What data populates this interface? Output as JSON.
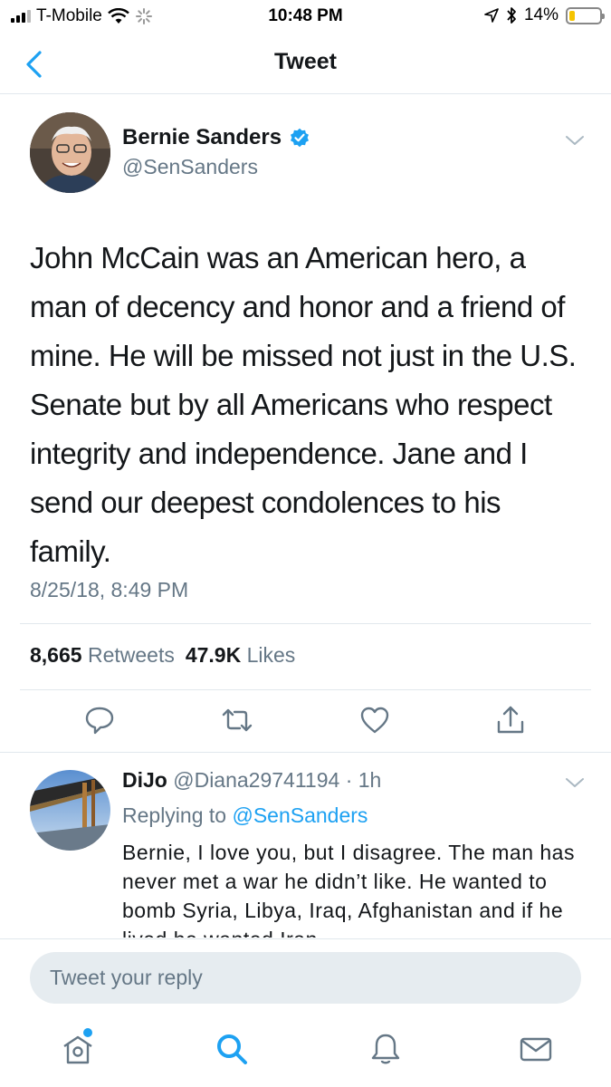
{
  "status_bar": {
    "carrier": "T-Mobile",
    "time": "10:48 PM",
    "battery": "14%",
    "battery_level": 0.14
  },
  "nav": {
    "title": "Tweet"
  },
  "tweet": {
    "author_name": "Bernie Sanders",
    "author_handle": "@SenSanders",
    "text": "John McCain was an American hero, a man of decency and honor and a friend of mine. He will be missed not just in the U.S. Senate but by all Americans who respect integrity and independence. Jane and I send our deepest condolences to his family.",
    "timestamp": "8/25/18, 8:49 PM",
    "retweets_count": "8,665",
    "retweets_label": "Retweets",
    "likes_count": "47.9K",
    "likes_label": "Likes"
  },
  "reply": {
    "name": "DiJo",
    "handle": "@Diana29741194",
    "age": "· 1h",
    "replying_label": "Replying to",
    "replying_to": "@SenSanders",
    "text": "Bernie, I love you, but I disagree. The man has never met a war he didn’t like. He wanted to bomb Syria, Libya, Iraq, Afghanistan and if he lived he wanted Iran."
  },
  "reply_box": {
    "placeholder": "Tweet your reply"
  },
  "colors": {
    "accent": "#1da1f2",
    "text": "#14171a",
    "muted": "#657786",
    "divider": "#e1e8ed"
  },
  "icons": {
    "back": "chevron-left-icon",
    "reply": "speech-bubble-icon",
    "retweet": "retweet-icon",
    "like": "heart-icon",
    "share": "share-icon",
    "home": "home-icon",
    "search": "search-icon",
    "notifications": "bell-icon",
    "messages": "envelope-icon"
  }
}
